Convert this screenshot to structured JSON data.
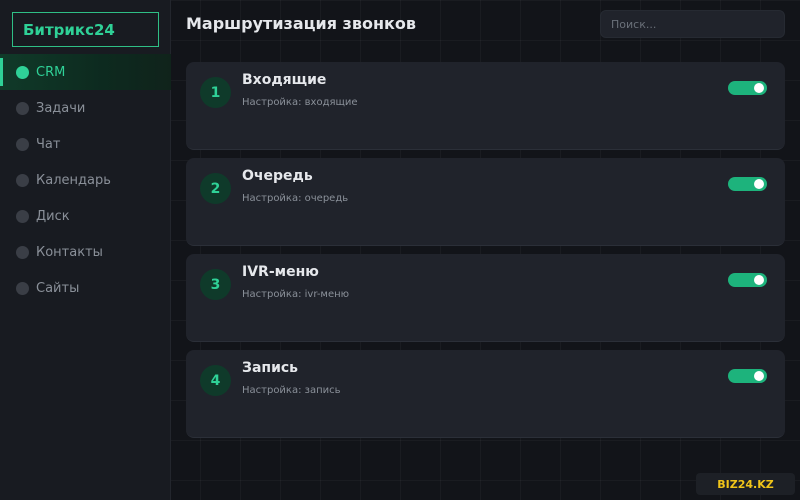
{
  "app": {
    "logo": "Битрикс24"
  },
  "sidebar": {
    "items": [
      {
        "label": "CRM",
        "active": true
      },
      {
        "label": "Задачи",
        "active": false
      },
      {
        "label": "Чат",
        "active": false
      },
      {
        "label": "Календарь",
        "active": false
      },
      {
        "label": "Диск",
        "active": false
      },
      {
        "label": "Контакты",
        "active": false
      },
      {
        "label": "Сайты",
        "active": false
      }
    ]
  },
  "header": {
    "title": "Маршрутизация звонков",
    "search_placeholder": "Поиск..."
  },
  "cards": [
    {
      "number": "1",
      "title": "Входящие",
      "subtitle": "Настройка: входящие",
      "enabled": true
    },
    {
      "number": "2",
      "title": "Очередь",
      "subtitle": "Настройка: очередь",
      "enabled": true
    },
    {
      "number": "3",
      "title": "IVR-меню",
      "subtitle": "Настройка: ivr-меню",
      "enabled": true
    },
    {
      "number": "4",
      "title": "Запись",
      "subtitle": "Настройка: запись",
      "enabled": true
    }
  ],
  "watermark": "BIZ24.KZ",
  "colors": {
    "accent": "#2fd197",
    "toggle_on": "#1db37c",
    "background": "#121419",
    "card": "#20232b",
    "watermark_text": "#f0c419"
  }
}
